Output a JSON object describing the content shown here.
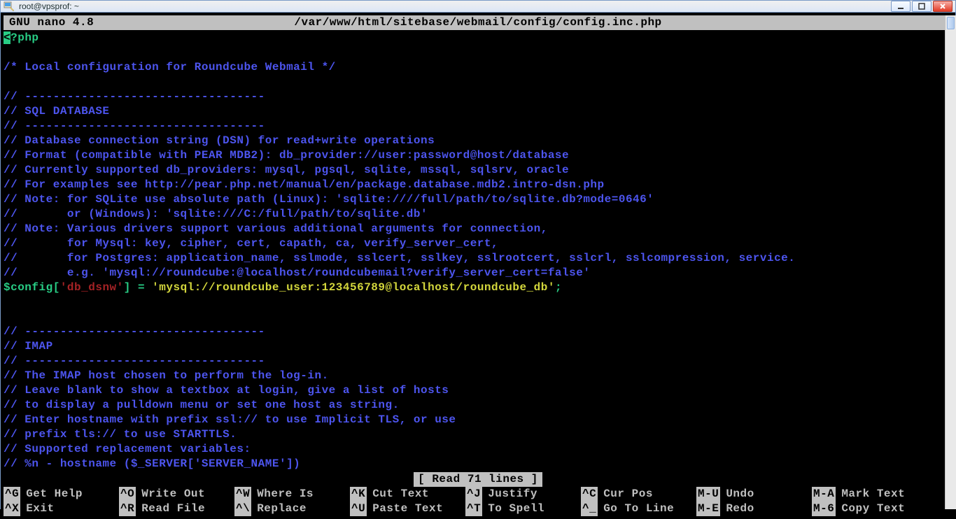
{
  "window": {
    "title": "root@vpsprof: ~"
  },
  "nano": {
    "version": "GNU  nano  4.8",
    "file_path": "/var/www/html/sitebase/webmail/config/config.inc.php",
    "status": "[ Read 71 lines ]"
  },
  "code": {
    "phptag": "<?php",
    "l03": "/* Local configuration for Roundcube Webmail */",
    "l05": "// ----------------------------------",
    "l06": "// SQL DATABASE",
    "l07": "// ----------------------------------",
    "l08": "// Database connection string (DSN) for read+write operations",
    "l09": "// Format (compatible with PEAR MDB2): db_provider://user:password@host/database",
    "l10": "// Currently supported db_providers: mysql, pgsql, sqlite, mssql, sqlsrv, oracle",
    "l11": "// For examples see http://pear.php.net/manual/en/package.database.mdb2.intro-dsn.php",
    "l12": "// Note: for SQLite use absolute path (Linux): 'sqlite:////full/path/to/sqlite.db?mode=0646'",
    "l13": "//       or (Windows): 'sqlite:///C:/full/path/to/sqlite.db'",
    "l14": "// Note: Various drivers support various additional arguments for connection,",
    "l15": "//       for Mysql: key, cipher, cert, capath, ca, verify_server_cert,",
    "l16": "//       for Postgres: application_name, sslmode, sslcert, sslkey, sslrootcert, sslcrl, sslcompression, service.",
    "l17": "//       e.g. 'mysql://roundcube:@localhost/roundcubemail?verify_server_cert=false'",
    "cfg_var": "$config",
    "cfg_key": "'db_dsnw'",
    "cfg_val": "'mysql://roundcube_user:123456789@localhost/roundcube_db'",
    "l21": "// ----------------------------------",
    "l22": "// IMAP",
    "l23": "// ----------------------------------",
    "l24": "// The IMAP host chosen to perform the log-in.",
    "l25": "// Leave blank to show a textbox at login, give a list of hosts",
    "l26": "// to display a pulldown menu or set one host as string.",
    "l27": "// Enter hostname with prefix ssl:// to use Implicit TLS, or use",
    "l28": "// prefix tls:// to use STARTTLS.",
    "l29": "// Supported replacement variables:",
    "l30": "// %n - hostname ($_SERVER['SERVER_NAME'])"
  },
  "shortcuts": {
    "row1": [
      {
        "key": "^G",
        "action": "Get Help"
      },
      {
        "key": "^O",
        "action": "Write Out"
      },
      {
        "key": "^W",
        "action": "Where Is"
      },
      {
        "key": "^K",
        "action": "Cut Text"
      },
      {
        "key": "^J",
        "action": "Justify"
      },
      {
        "key": "^C",
        "action": "Cur Pos"
      },
      {
        "key": "M-U",
        "action": "Undo"
      },
      {
        "key": "M-A",
        "action": "Mark Text"
      }
    ],
    "row2": [
      {
        "key": "^X",
        "action": "Exit"
      },
      {
        "key": "^R",
        "action": "Read File"
      },
      {
        "key": "^\\",
        "action": "Replace"
      },
      {
        "key": "^U",
        "action": "Paste Text"
      },
      {
        "key": "^T",
        "action": "To Spell"
      },
      {
        "key": "^_",
        "action": "Go To Line"
      },
      {
        "key": "M-E",
        "action": "Redo"
      },
      {
        "key": "M-6",
        "action": "Copy Text"
      }
    ]
  }
}
